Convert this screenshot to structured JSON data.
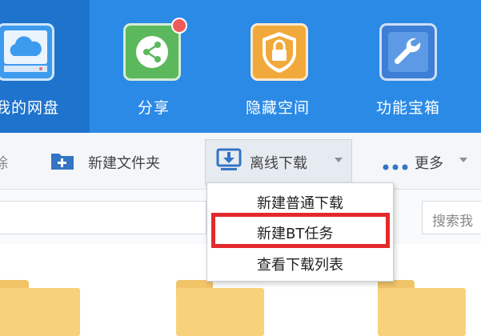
{
  "nav": {
    "items": [
      {
        "label": "我的网盘",
        "icon": "cloud-icon",
        "active": true
      },
      {
        "label": "分享",
        "icon": "share-icon",
        "badge": "notification-dot"
      },
      {
        "label": "隐藏空间",
        "icon": "lock-icon"
      },
      {
        "label": "功能宝箱",
        "icon": "wrench-icon"
      }
    ]
  },
  "toolbar": {
    "partial_left": "除",
    "new_folder": "新建文件夹",
    "offline_download": "离线下载",
    "more": "更多"
  },
  "address": {
    "search_placeholder": "搜索我"
  },
  "dropdown": {
    "items": [
      "新建普通下载",
      "新建BT任务",
      "查看下载列表"
    ],
    "highlighted_index": 1
  },
  "colors": {
    "nav_bg": "#2b8ae6",
    "nav_active": "#1e73cd",
    "highlight_border": "#e32a2a",
    "folder": "#f8d27b"
  }
}
